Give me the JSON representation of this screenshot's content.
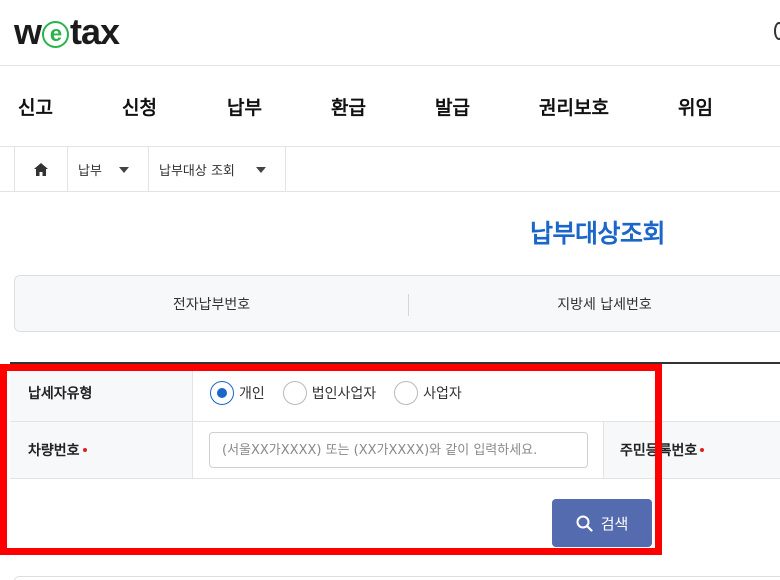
{
  "logo": {
    "prefix": "w",
    "e": "e",
    "suffix": "tax"
  },
  "main_nav": [
    "신고",
    "신청",
    "납부",
    "환급",
    "발급",
    "권리보호",
    "위임"
  ],
  "breadcrumb": {
    "level1": "납부",
    "level2": "납부대상 조회"
  },
  "page_title": "납부대상조회",
  "tabs": [
    "전자납부번호",
    "지방세 납세번호"
  ],
  "form": {
    "taxpayer_type_label": "납세자유형",
    "taxpayer_options": [
      {
        "label": "개인",
        "checked": true
      },
      {
        "label": "법인사업자",
        "checked": false
      },
      {
        "label": "사업자",
        "checked": false
      }
    ],
    "vehicle_number_label": "차량번호",
    "vehicle_number_placeholder": "(서울XX가XXXX) 또는 (XX가XXXX)와 같이 입력하세요.",
    "resident_number_label": "주민등록번호",
    "search_button": "검색"
  },
  "colors": {
    "accent": "#1a66c9",
    "button": "#556bb0",
    "highlight": "#ff0000",
    "required": "#e02020"
  }
}
